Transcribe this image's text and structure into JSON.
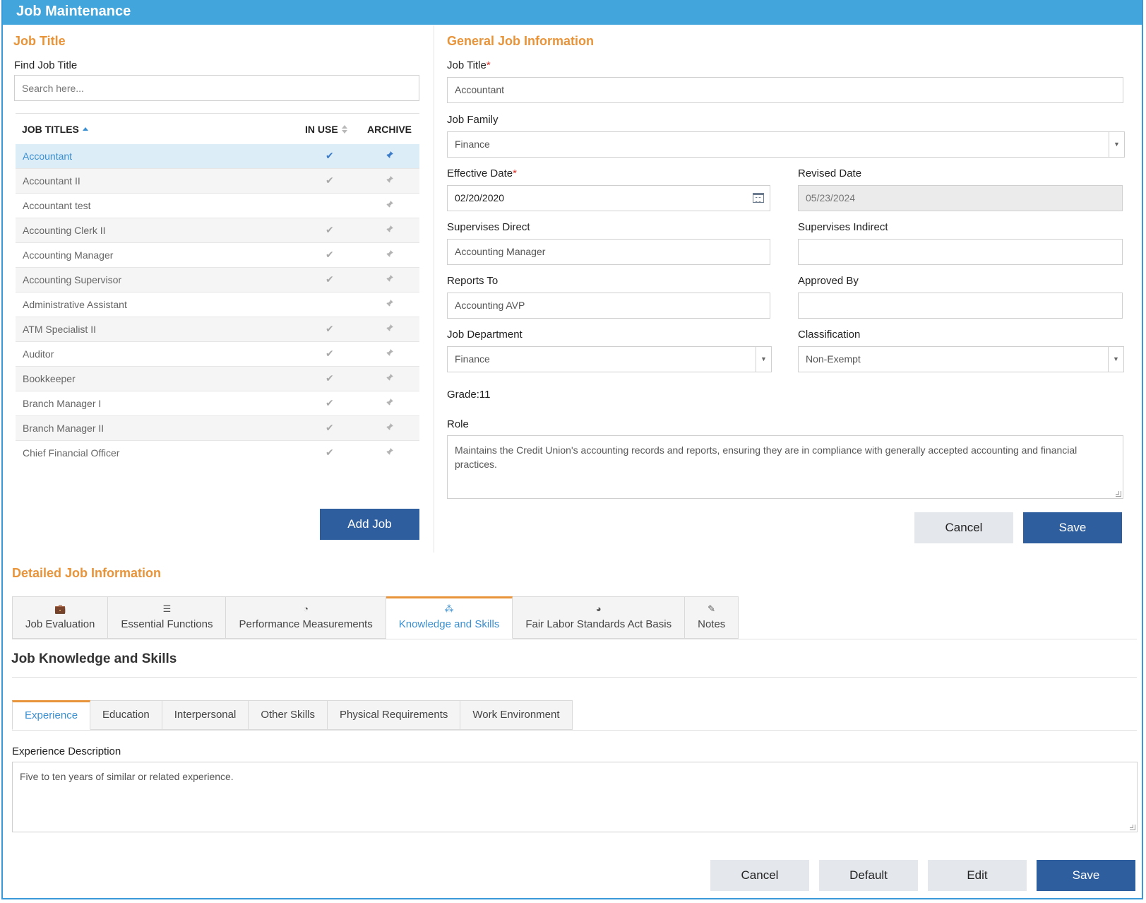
{
  "window": {
    "title": "Job Maintenance"
  },
  "job_title_panel": {
    "heading": "Job Title",
    "find_label": "Find Job Title",
    "search_placeholder": "Search here...",
    "columns": {
      "title": "JOB TITLES",
      "in_use": "IN USE",
      "archive": "ARCHIVE"
    },
    "rows": [
      {
        "name": "Accountant",
        "in_use": true,
        "selected": true
      },
      {
        "name": "Accountant II",
        "in_use": true
      },
      {
        "name": "Accountant test",
        "in_use": false
      },
      {
        "name": "Accounting Clerk II",
        "in_use": true
      },
      {
        "name": "Accounting Manager",
        "in_use": true
      },
      {
        "name": "Accounting Supervisor",
        "in_use": true
      },
      {
        "name": "Administrative Assistant",
        "in_use": false
      },
      {
        "name": "ATM Specialist II",
        "in_use": true
      },
      {
        "name": "Auditor",
        "in_use": true
      },
      {
        "name": "Bookkeeper",
        "in_use": true
      },
      {
        "name": "Branch Manager I",
        "in_use": true
      },
      {
        "name": "Branch Manager II",
        "in_use": true
      },
      {
        "name": "Chief Financial Officer",
        "in_use": true
      }
    ],
    "add_button": "Add Job"
  },
  "general": {
    "heading": "General Job Information",
    "job_title_label": "Job Title",
    "job_title_value": "Accountant",
    "job_family_label": "Job Family",
    "job_family_value": "Finance",
    "effective_date_label": "Effective Date",
    "effective_date_value": "02/20/2020",
    "revised_date_label": "Revised Date",
    "revised_date_value": "05/23/2024",
    "supervises_direct_label": "Supervises Direct",
    "supervises_direct_value": "Accounting Manager",
    "supervises_indirect_label": "Supervises Indirect",
    "supervises_indirect_value": "",
    "reports_to_label": "Reports To",
    "reports_to_value": "Accounting AVP",
    "approved_by_label": "Approved By",
    "approved_by_value": "",
    "job_department_label": "Job Department",
    "job_department_value": "Finance",
    "classification_label": "Classification",
    "classification_value": "Non-Exempt",
    "grade_text": "Grade:11",
    "role_label": "Role",
    "role_value": "Maintains the Credit Union's accounting records and reports, ensuring they are in compliance with generally accepted accounting and financial practices.",
    "cancel_button": "Cancel",
    "save_button": "Save"
  },
  "detailed": {
    "heading": "Detailed Job Information",
    "tabs": [
      {
        "label": "Job Evaluation",
        "icon": "briefcase-icon"
      },
      {
        "label": "Essential Functions",
        "icon": "list-icon"
      },
      {
        "label": "Performance Measurements",
        "icon": "dashboard-icon"
      },
      {
        "label": "Knowledge and Skills",
        "icon": "cubes-icon",
        "active": true
      },
      {
        "label": "Fair Labor Standards Act Basis",
        "icon": "pie-chart-icon"
      },
      {
        "label": "Notes",
        "icon": "edit-icon"
      }
    ],
    "section_title": "Job Knowledge and Skills",
    "subtabs": [
      {
        "label": "Experience",
        "active": true
      },
      {
        "label": "Education"
      },
      {
        "label": "Interpersonal"
      },
      {
        "label": "Other Skills"
      },
      {
        "label": "Physical Requirements"
      },
      {
        "label": "Work Environment"
      }
    ],
    "experience_label": "Experience Description",
    "experience_value": "Five to ten years of similar or related experience.",
    "buttons": {
      "cancel": "Cancel",
      "default": "Default",
      "edit": "Edit",
      "save": "Save"
    }
  },
  "colors": {
    "accent": "#e8943a",
    "header": "#42a5dc",
    "primary_button": "#2f5e9e",
    "link": "#3a8fd1"
  }
}
